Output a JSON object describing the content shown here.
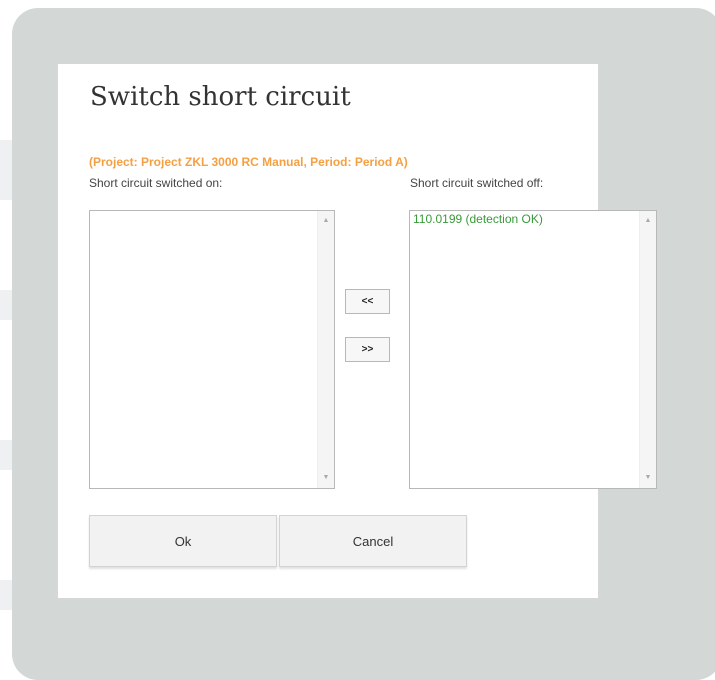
{
  "dialog": {
    "title": "Switch short circuit",
    "project_info": "(Project: Project ZKL 3000 RC Manual, Period: Period A)",
    "list_on": {
      "label": "Short circuit switched on:",
      "items": []
    },
    "list_off": {
      "label": "Short circuit switched off:",
      "items": [
        "110.0199 (detection OK)"
      ]
    },
    "move_left_label": "<<",
    "move_right_label": ">>",
    "ok_label": "Ok",
    "cancel_label": "Cancel"
  },
  "icons": {
    "scroll_up": "scroll-up-icon",
    "scroll_down": "scroll-down-icon"
  },
  "colors": {
    "backdrop": "#d3d8d6",
    "project_info": "#f5a042",
    "list_item_ok": "#3a9a3a"
  }
}
